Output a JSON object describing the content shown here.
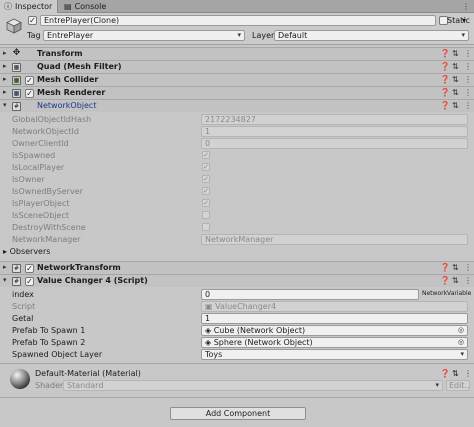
{
  "tabs": [
    {
      "label": "Inspector",
      "icon": "info-icon"
    },
    {
      "label": "Console",
      "icon": "console-icon"
    }
  ],
  "header": {
    "name": "EntrePlayer(Clone)",
    "static_label": "Static",
    "tag_label": "Tag",
    "tag_value": "EntrePlayer",
    "layer_label": "Layer",
    "layer_value": "Default"
  },
  "components": {
    "transform": "Transform",
    "quad": "Quad (Mesh Filter)",
    "mesh_collider": "Mesh Collider",
    "mesh_renderer": "Mesh Renderer",
    "network_object": "NetworkObject",
    "network_transform": "NetworkTransform",
    "value_changer": "Value Changer 4 (Script)"
  },
  "network_object_fields": [
    {
      "label": "GlobalObjectIdHash",
      "value": "2172234827"
    },
    {
      "label": "NetworkObjectId",
      "value": "1"
    },
    {
      "label": "OwnerClientId",
      "value": "0"
    },
    {
      "label": "IsSpawned",
      "checked": true
    },
    {
      "label": "IsLocalPlayer",
      "checked": true
    },
    {
      "label": "IsOwner",
      "checked": true
    },
    {
      "label": "IsOwnedByServer",
      "checked": true
    },
    {
      "label": "IsPlayerObject",
      "checked": true
    },
    {
      "label": "IsSceneObject",
      "checked": false
    },
    {
      "label": "DestroyWithScene",
      "checked": false
    },
    {
      "label": "NetworkManager",
      "value": "NetworkManager"
    }
  ],
  "observers_label": "Observers",
  "script_fields": {
    "index_label": "index",
    "index_value": "0",
    "index_badge": "NetworkVariable",
    "script_label": "Script",
    "script_value": "ValueChanger4",
    "getal_label": "Getal",
    "getal_value": "1",
    "prefab1_label": "Prefab To Spawn 1",
    "prefab1_value": "Cube (Network Object)",
    "prefab2_label": "Prefab To Spawn 2",
    "prefab2_value": "Sphere (Network Object)",
    "layer_label": "Spawned Object Layer",
    "layer_value": "Toys"
  },
  "material": {
    "name": "Default-Material (Material)",
    "shader_label": "Shader",
    "shader_value": "Standard",
    "edit_label": "Edit..."
  },
  "add_component": "Add Component"
}
